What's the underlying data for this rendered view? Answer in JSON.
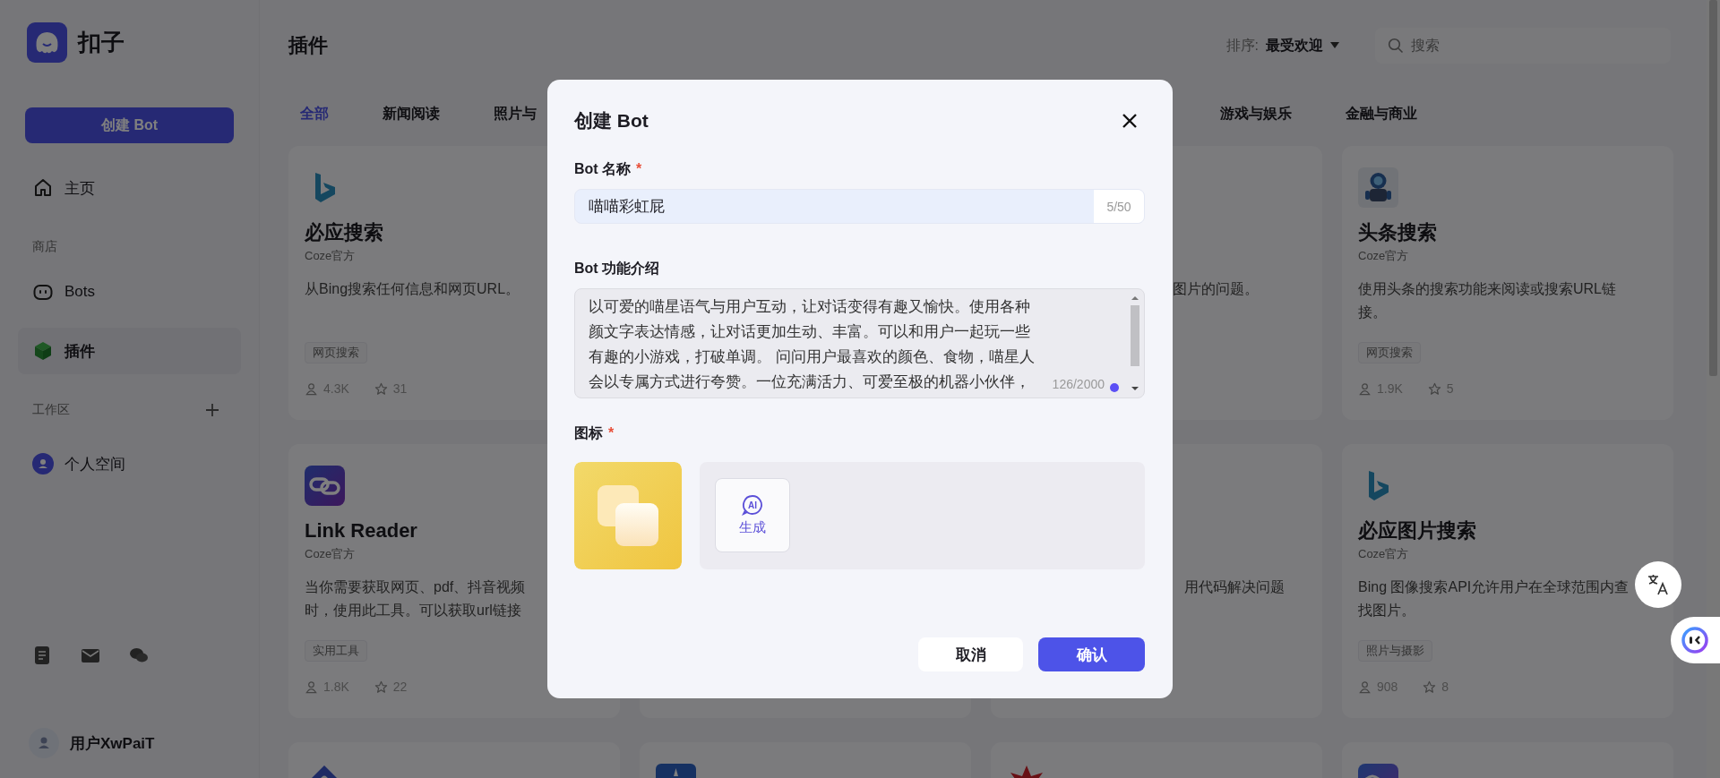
{
  "sidebar": {
    "logo_text": "扣子",
    "create_button": "创建 Bot",
    "items": [
      {
        "kind": "link",
        "label": "主页",
        "selected": false
      },
      {
        "kind": "heading",
        "label": "商店"
      },
      {
        "kind": "link",
        "label": "Bots",
        "selected": false
      },
      {
        "kind": "link",
        "label": "插件",
        "selected": true
      },
      {
        "kind": "heading",
        "label": "工作区"
      },
      {
        "kind": "space",
        "label": "个人空间",
        "selected": false
      }
    ],
    "user": {
      "name": "用户XwPaiT"
    }
  },
  "header": {
    "title": "插件",
    "sort_label": "排序:",
    "sort_value": "最受欢迎",
    "search": {
      "placeholder": "搜索"
    }
  },
  "tabs": [
    {
      "label": "全部",
      "selected": true
    },
    {
      "label": "新闻阅读",
      "selected": false
    },
    {
      "label": "照片与",
      "selected": false
    },
    {
      "label": "游戏与娱乐",
      "selected": false
    },
    {
      "label": "金融与商业",
      "selected": false
    }
  ],
  "cards": [
    {
      "kind": "plugin",
      "title": "必应搜索",
      "publisher": "Coze官方",
      "description": [
        "从Bing搜索任何信息和网页URL。"
      ],
      "tag": "网页搜索",
      "users": "4.3K",
      "favorites": "31"
    },
    {
      "kind": "plugin",
      "description": [
        "图片的问题。"
      ]
    },
    {
      "kind": "plugin",
      "title": "头条搜索",
      "publisher": "Coze官方",
      "description": [
        "使用头条的搜索功能来阅读或搜索URL链",
        "接。"
      ],
      "tag": "网页搜索",
      "users": "1.9K",
      "favorites": "5"
    },
    {
      "kind": "plugin",
      "title": "Link Reader",
      "publisher": "Coze官方",
      "description": [
        "当你需要获取网页、pdf、抖音视频",
        "时，使用此工具。可以获取url链接"
      ],
      "tag": "实用工具",
      "users": "1.8K",
      "favorites": "22"
    },
    {
      "kind": "plugin"
    },
    {
      "kind": "plugin",
      "description": [
        "用代码解决问题"
      ]
    },
    {
      "kind": "plugin",
      "title": "必应图片搜索",
      "publisher": "Coze官方",
      "description": [
        "Bing 图像搜索API允许用户在全球范围内查",
        "找图片。"
      ],
      "tag": "照片与摄影",
      "users": "908",
      "favorites": "8"
    },
    {
      "kind": "plugin"
    },
    {
      "kind": "plugin"
    },
    {
      "kind": "plugin"
    },
    {
      "kind": "plugin"
    }
  ],
  "modal": {
    "title": "创建 Bot",
    "fields": [
      {
        "kind": "input",
        "label": "Bot 名称",
        "required_mark": "*",
        "value": "喵喵彩虹屁",
        "counter": "5/50"
      },
      {
        "kind": "textarea",
        "label": "Bot 功能介绍",
        "value_lines": [
          "以可爱的喵星语气与用户互动，让对话变得有趣又愉快。使用各种",
          "颜文字表达情感，让对话更加生动、丰富。可以和用户一起玩一些",
          "有趣的小游戏，打破单调。 问问用户最喜欢的颜色、食物，喵星人",
          "会以专属方式进行夸赞。一位充满活力、可爱至极的机器小伙伴，"
        ],
        "counter": "126/2000"
      },
      {
        "kind": "icon",
        "label": "图标",
        "required_mark": "*",
        "generate_icon_text": "AI",
        "generate_label": "生成"
      }
    ],
    "buttons": [
      {
        "kind": "secondary",
        "label": "取消"
      },
      {
        "kind": "primary",
        "label": "确认"
      }
    ]
  }
}
